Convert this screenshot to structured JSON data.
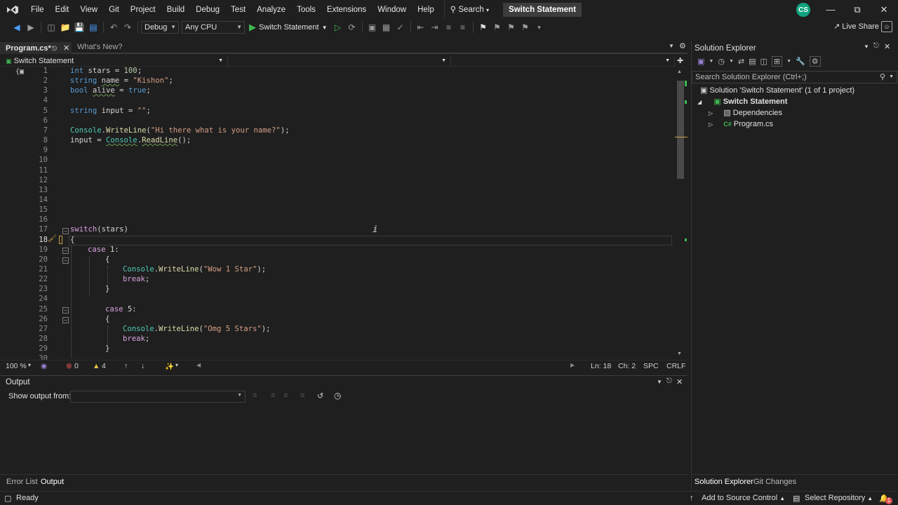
{
  "menu": {
    "items": [
      "File",
      "Edit",
      "View",
      "Git",
      "Project",
      "Build",
      "Debug",
      "Test",
      "Analyze",
      "Tools",
      "Extensions",
      "Window",
      "Help"
    ],
    "search_label": "Search",
    "solution_title": "Switch Statement",
    "account_initials": "CS"
  },
  "toolbar": {
    "config": "Debug",
    "platform": "Any CPU",
    "run_target": "Switch Statement",
    "live_share": "Live Share"
  },
  "doc_tabs": {
    "active": "Program.cs*",
    "other": "What's New?"
  },
  "nav_bar": {
    "project": "Switch Statement"
  },
  "editor": {
    "lines": [
      {
        "n": "1"
      },
      {
        "n": "2"
      },
      {
        "n": "3"
      },
      {
        "n": "4"
      },
      {
        "n": "5"
      },
      {
        "n": "6"
      },
      {
        "n": "7"
      },
      {
        "n": "8"
      },
      {
        "n": "9"
      },
      {
        "n": "10"
      },
      {
        "n": "11"
      },
      {
        "n": "12"
      },
      {
        "n": "13"
      },
      {
        "n": "14"
      },
      {
        "n": "15"
      },
      {
        "n": "16"
      },
      {
        "n": "17"
      },
      {
        "n": "18"
      },
      {
        "n": "19"
      },
      {
        "n": "20"
      },
      {
        "n": "21"
      },
      {
        "n": "22"
      },
      {
        "n": "23"
      },
      {
        "n": "24"
      },
      {
        "n": "25"
      },
      {
        "n": "26"
      },
      {
        "n": "27"
      },
      {
        "n": "28"
      },
      {
        "n": "29"
      },
      {
        "n": "30"
      }
    ],
    "code": {
      "l1_kw": "int",
      "l1_rest": " stars = ",
      "l1_num": "100",
      "l1_end": ";",
      "l2_kw": "string",
      "l2_var": "name",
      "l2_mid": " = ",
      "l2_str": "\"Kishon\"",
      "l2_end": ";",
      "l3_kw": "bool",
      "l3_var": "alive",
      "l3_mid": " = ",
      "l3_val": "true",
      "l3_end": ";",
      "l5_kw": "string",
      "l5_rest": " input = ",
      "l5_str": "\"\"",
      "l5_end": ";",
      "l7_cls": "Console",
      "l7_dot": ".",
      "l7_mth": "WriteLine",
      "l7_open": "(",
      "l7_str": "\"Hi there what is your name?\"",
      "l7_end": ");",
      "l8_var": "input",
      "l8_mid": " = ",
      "l8_cls": "Console",
      "l8_dot": ".",
      "l8_mth": "ReadLine",
      "l8_end": "();",
      "l17_kw": "switch",
      "l17_rest": "(stars)",
      "l18": "{",
      "l19_kw": "case",
      "l19_rest": " 1:",
      "l20": "{",
      "l21_cls": "Console",
      "l21_dot": ".",
      "l21_mth": "WriteLine",
      "l21_open": "(",
      "l21_str": "\"Wow 1 Star\"",
      "l21_end": ");",
      "l22_kw": "break",
      "l22_end": ";",
      "l23": "}",
      "l25_kw": "case",
      "l25_rest": " 5:",
      "l26": "{",
      "l27_cls": "Console",
      "l27_dot": ".",
      "l27_mth": "WriteLine",
      "l27_open": "(",
      "l27_str": "\"Omg 5 Stars\"",
      "l27_end": ");",
      "l28_kw": "break",
      "l28_end": ";",
      "l29": "}"
    }
  },
  "editor_status": {
    "zoom": "100 %",
    "errors": "0",
    "warnings": "4",
    "line": "Ln: 18",
    "char": "Ch: 2",
    "spacing": "SPC",
    "line_ending": "CRLF"
  },
  "output": {
    "title": "Output",
    "show_from_label": "Show output from:"
  },
  "bottom_tabs": {
    "error_list": "Error List",
    "output": "Output"
  },
  "solution_explorer": {
    "title": "Solution Explorer",
    "search_placeholder": "Search Solution Explorer (Ctrl+;)",
    "solution_node": "Solution 'Switch Statement' (1 of 1 project)",
    "project_node": "Switch Statement",
    "dependencies": "Dependencies",
    "program": "Program.cs",
    "tab_solution": "Solution Explorer",
    "tab_git": "Git Changes"
  },
  "statusbar": {
    "ready": "Ready",
    "source_control": "Add to Source Control",
    "repository": "Select Repository",
    "notification_count": "1"
  },
  "colors": {
    "keyword": "#569cd6",
    "control_keyword": "#d8a0df",
    "string": "#d69d85",
    "method": "#dcdcaa",
    "class": "#4ec9b0",
    "background": "#1f1f1f",
    "error": "#e05252",
    "warning": "#e8c54a",
    "run_green": "#3fb950"
  }
}
